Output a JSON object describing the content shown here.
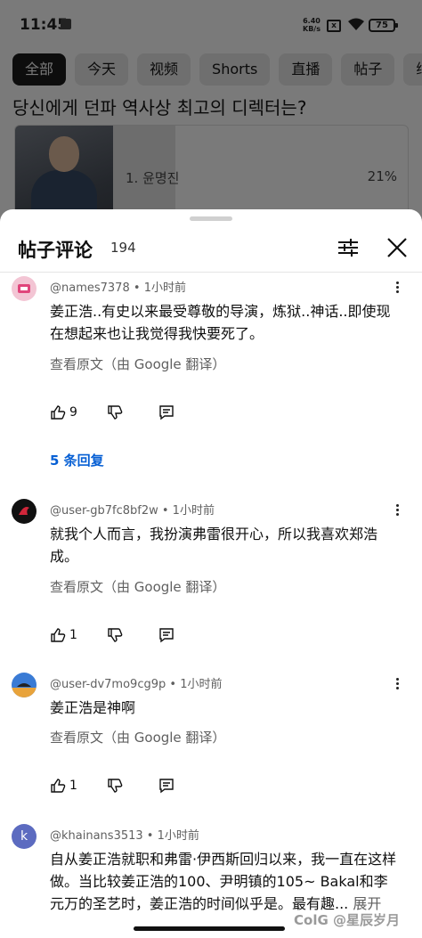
{
  "status_bar": {
    "time": "11:45",
    "speed_value": "6.40",
    "speed_unit": "KB/s",
    "sim": "x",
    "battery": "75"
  },
  "background": {
    "chips": [
      "全部",
      "今天",
      "视频",
      "Shorts",
      "直播",
      "帖子",
      "继"
    ],
    "post_title": "당신에게 던파 역사상 최고의 디렉터는?",
    "poll": {
      "option": "1. 윤명진",
      "percent": "21%",
      "fraction": 0.21
    }
  },
  "sheet": {
    "title": "帖子评论",
    "count": "194"
  },
  "comments": [
    {
      "user": "@names7378",
      "time": "1小时前",
      "text": "姜正浩..有史以来最受尊敬的导演，炼狱..神话..即使现在想起来也让我觉得我快要死了。",
      "translate": "查看原文（由 Google 翻译）",
      "likes": "9",
      "replies": "5 条回复"
    },
    {
      "user": "@user-gb7fc8bf2w",
      "time": "1小时前",
      "text": "就我个人而言，我扮演弗雷很开心，所以我喜欢郑浩成。",
      "translate": "查看原文（由 Google 翻译）",
      "likes": "1"
    },
    {
      "user": "@user-dv7mo9cg9p",
      "time": "1小时前",
      "text": "姜正浩是神啊",
      "translate": "查看原文（由 Google 翻译）",
      "likes": "1"
    },
    {
      "user": "@khainans3513",
      "time": "1小时前",
      "avatar_letter": "k",
      "text": "自从姜正浩就职和弗雷·伊西斯回归以来，我一直在这样做。当比较姜正浩的100、尹明镇的105~ Bakal和李元万的圣艺时，姜正浩的时间似乎是。最有趣...",
      "expand": "展开"
    }
  ],
  "watermark": "ColG @星辰岁月",
  "colors": {
    "link": "#065fd4",
    "secondary_text": "#606060",
    "overlay": "#7a7a7a"
  }
}
